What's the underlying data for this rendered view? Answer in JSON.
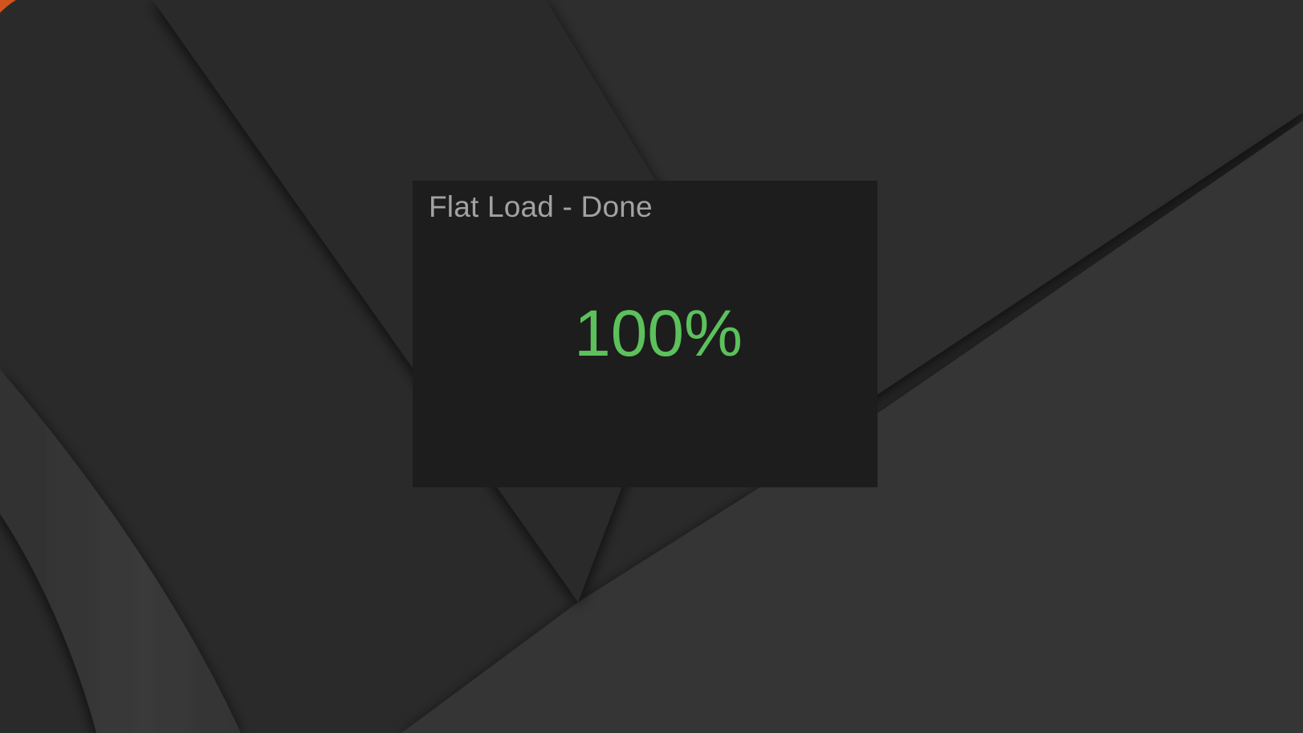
{
  "dialog": {
    "title": "Flat Load - Done",
    "progress_text": "100%",
    "progress_fraction": 1.0
  },
  "colors": {
    "wallpaper_base": "#2a2a2a",
    "dialog_background": "#1d1d1d",
    "title_text": "#a2a2a2",
    "progress_text": "#5cc15c",
    "corner_accent": "#d2541c"
  }
}
